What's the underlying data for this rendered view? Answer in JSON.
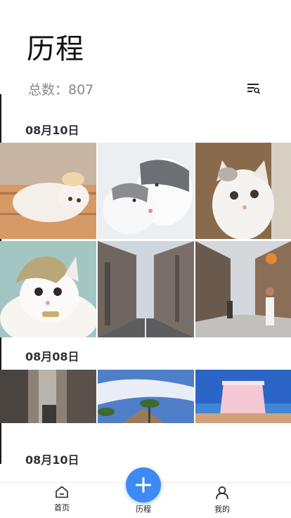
{
  "header": {
    "title": "历程",
    "count_label": "总数：807"
  },
  "sections": [
    {
      "date": "08月10日",
      "photos": [
        "cat-wearing-hat-lying-on-floor",
        "two-kittens-cuddling",
        "white-kitten-in-doorway",
        "kitten-in-knit-hat",
        "narrow-japanese-street",
        "city-street-with-pedestrians"
      ]
    },
    {
      "date": "08月08日",
      "photos": [
        "city-street-buildings",
        "sky-clouds-palm-trees",
        "beach-canopy-sunset"
      ]
    },
    {
      "date": "08月10日",
      "photos": []
    }
  ],
  "bottom_nav": {
    "home_label": "首页",
    "history_label": "历程",
    "mine_label": "我的",
    "accent_color": "#3d8bf2"
  }
}
